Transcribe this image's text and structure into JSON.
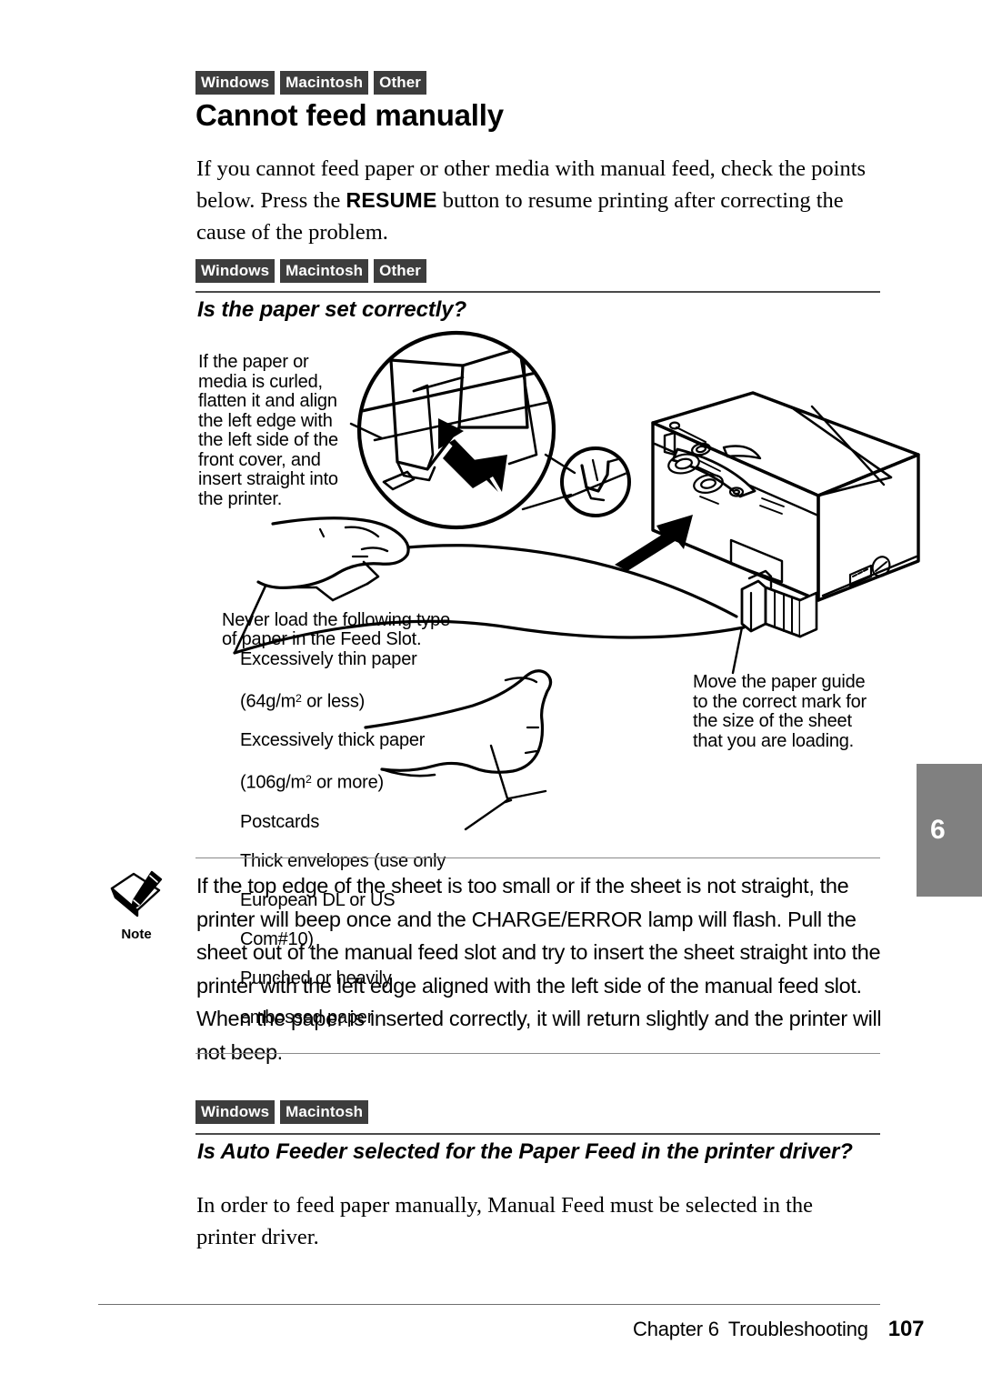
{
  "page": {
    "chapter_tab_number": "6",
    "accent_badge_color": "#3d3d3a",
    "tab_color": "#808080"
  },
  "section_one": {
    "os_badges": [
      "Windows",
      "Macintosh",
      "Other"
    ],
    "title": "Cannot feed manually",
    "intro_before": "If you cannot feed paper or other media with manual feed, check the points below. Press the ",
    "intro_bold": "RESUME",
    "intro_after": " button to resume printing after correcting the cause of the problem."
  },
  "subsection_paper": {
    "os_badges": [
      "Windows",
      "Macintosh",
      "Other"
    ],
    "heading": "Is the paper set correctly?"
  },
  "illustration": {
    "name": "printer-manual-feed-illustration",
    "callout_left_top": "If the paper or media is curled, flatten it and align the left edge with the left side of the front cover, and insert straight into the printer.",
    "callout_never_load_intro": "Never load the following type of paper in the Feed Slot.",
    "callout_never_load_items": [
      "Excessively thin paper",
      "(64g/m² or less)",
      "Excessively thick paper",
      "(106g/m² or more)",
      "Postcards",
      "Thick envelopes (use only",
      "European DL or US",
      "Com#10)",
      "Punched or heavily",
      "embossed paper"
    ],
    "callout_right": "Move the paper guide to the correct mark for the size of the sheet that you are loading."
  },
  "note_block": {
    "icon_label": "Note",
    "text": "If the top edge of the sheet is too small or if the sheet is not straight, the printer will beep once and the CHARGE/ERROR lamp will flash. Pull the sheet out of the manual feed slot and try to insert the sheet straight into the printer with the left edge aligned with the left side of the manual feed slot. When the paper is inserted correctly, it will return slightly and the printer will not beep."
  },
  "subsection_autofeeder": {
    "os_badges": [
      "Windows",
      "Macintosh"
    ],
    "heading": "Is Auto Feeder selected for the Paper Feed in the printer driver?",
    "body": "In order to feed paper manually, Manual Feed must be selected in the printer driver."
  },
  "footer": {
    "chapter": "Chapter 6",
    "section": "Troubleshooting",
    "page_number": "107"
  }
}
